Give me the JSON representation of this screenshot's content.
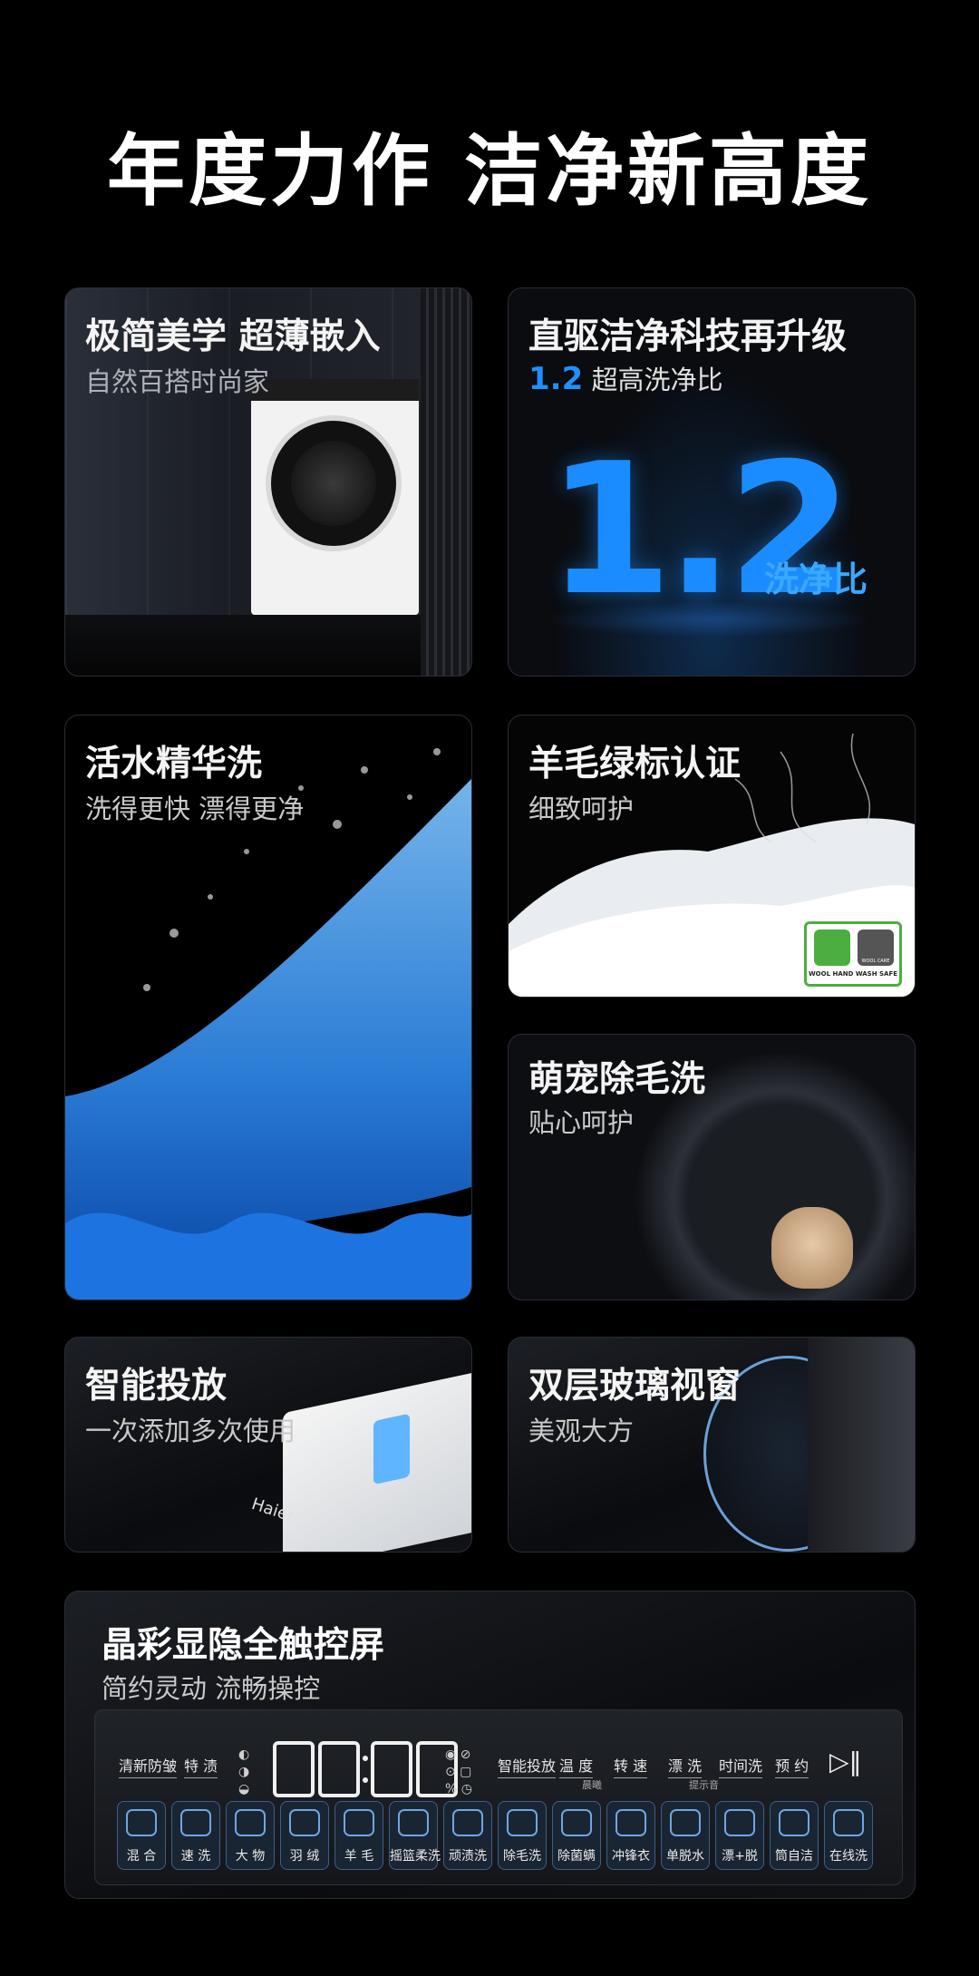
{
  "page_title": "年度力作 洁净新高度",
  "cards": {
    "slim": {
      "title": "极简美学 超薄嵌入",
      "subtitle": "自然百搭时尚家"
    },
    "ratio": {
      "title": "直驱洁净科技再升级",
      "highlight": "1.2",
      "subtitle": "超高洗净比",
      "big_number": "1.2",
      "big_label": "洗净比"
    },
    "water": {
      "title": "活水精华洗",
      "subtitle": "洗得更快 漂得更净"
    },
    "wool": {
      "title": "羊毛绿标认证",
      "subtitle": "细致呵护",
      "badge_small": "WOOL CARE",
      "badge_text": "WOOL HAND WASH SAFE"
    },
    "pet": {
      "title": "萌宠除毛洗",
      "subtitle": "贴心呵护"
    },
    "dispense": {
      "title": "智能投放",
      "subtitle": "一次添加多次使用",
      "brand": "Haier"
    },
    "window": {
      "title": "双层玻璃视窗",
      "subtitle": "美观大方"
    },
    "screen": {
      "title": "晶彩显隐全触控屏",
      "subtitle": "简约灵动 流畅操控"
    }
  },
  "panel": {
    "left_labels": [
      "清新防皱",
      "特 渍"
    ],
    "display": "88:88",
    "right_labels": [
      "智能投放",
      "温 度",
      "转 速",
      "漂 洗",
      "时间洗",
      "预 约"
    ],
    "sub_labels": [
      "晨曦",
      "提示音"
    ],
    "play_icon": "play-pause-icon",
    "programs": [
      "混 合",
      "速 洗",
      "大 物",
      "羽 绒",
      "羊 毛",
      "摇篮柔洗",
      "顽渍洗",
      "除毛洗",
      "除菌螨",
      "冲锋衣",
      "单脱水",
      "漂+脱",
      "筒自洁",
      "在线洗"
    ]
  },
  "colors": {
    "accent_blue": "#1e90ff",
    "wool_green": "#4cae3f",
    "background": "#000000"
  }
}
